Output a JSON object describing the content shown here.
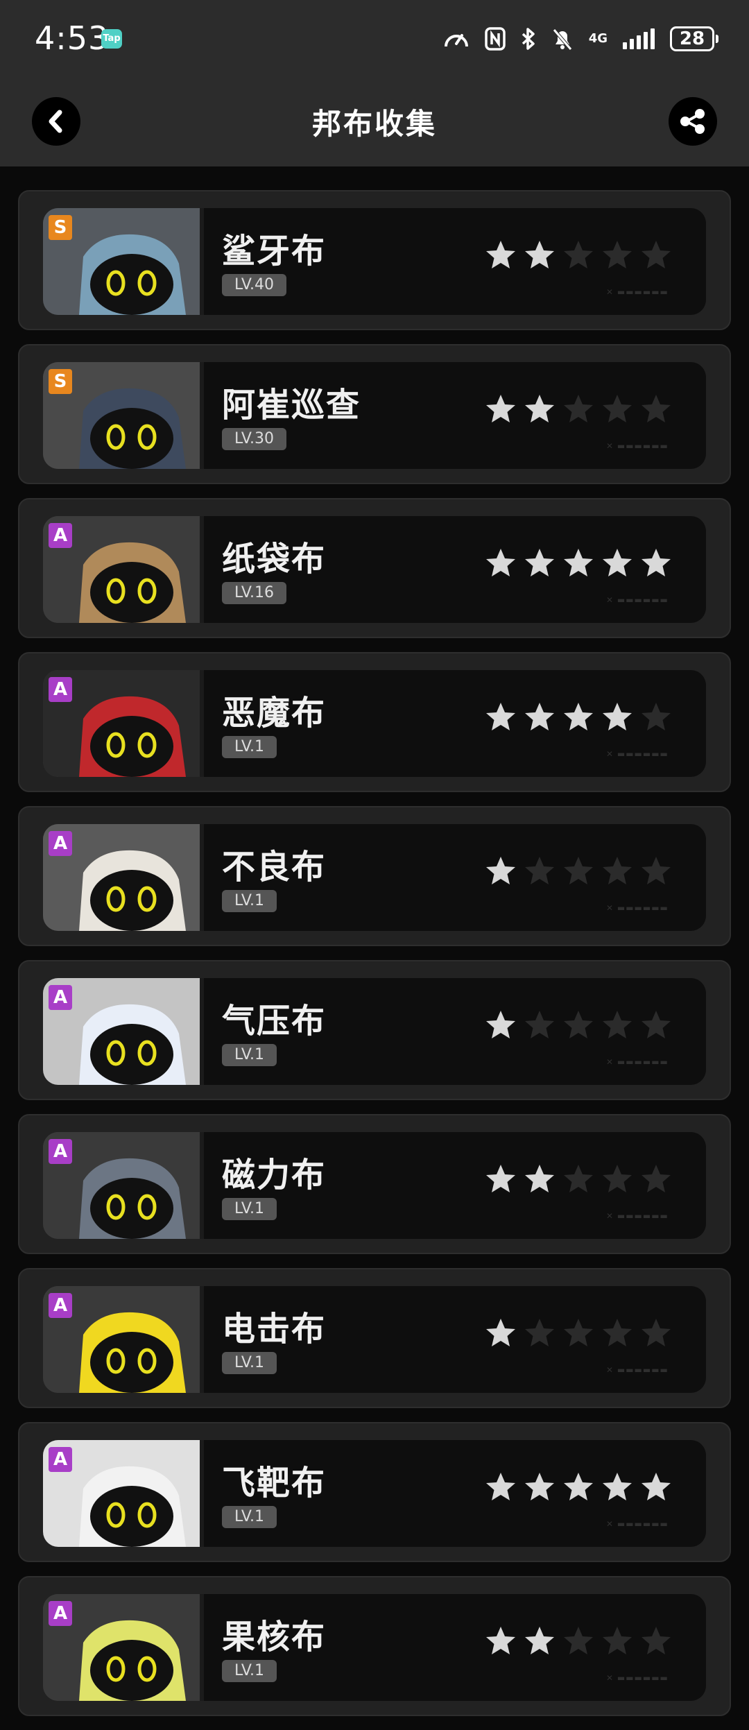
{
  "status_bar": {
    "time": "4:53",
    "app_badge": "Tap",
    "network": "4G",
    "battery": "28"
  },
  "header": {
    "title": "邦布收集"
  },
  "colors": {
    "rank_s": "#e8871e",
    "rank_a": "#a83ec7",
    "star_on": "#d9d9d9",
    "star_off": "#2b2b2b"
  },
  "bangboos": [
    {
      "rank": "S",
      "name": "鲨牙布",
      "level": "LV.40",
      "stars": 2
    },
    {
      "rank": "S",
      "name": "阿崔巡查",
      "level": "LV.30",
      "stars": 2
    },
    {
      "rank": "A",
      "name": "纸袋布",
      "level": "LV.16",
      "stars": 5
    },
    {
      "rank": "A",
      "name": "恶魔布",
      "level": "LV.1",
      "stars": 4
    },
    {
      "rank": "A",
      "name": "不良布",
      "level": "LV.1",
      "stars": 1
    },
    {
      "rank": "A",
      "name": "气压布",
      "level": "LV.1",
      "stars": 1
    },
    {
      "rank": "A",
      "name": "磁力布",
      "level": "LV.1",
      "stars": 2
    },
    {
      "rank": "A",
      "name": "电击布",
      "level": "LV.1",
      "stars": 1
    },
    {
      "rank": "A",
      "name": "飞靶布",
      "level": "LV.1",
      "stars": 5
    },
    {
      "rank": "A",
      "name": "果核布",
      "level": "LV.1",
      "stars": 2
    }
  ]
}
